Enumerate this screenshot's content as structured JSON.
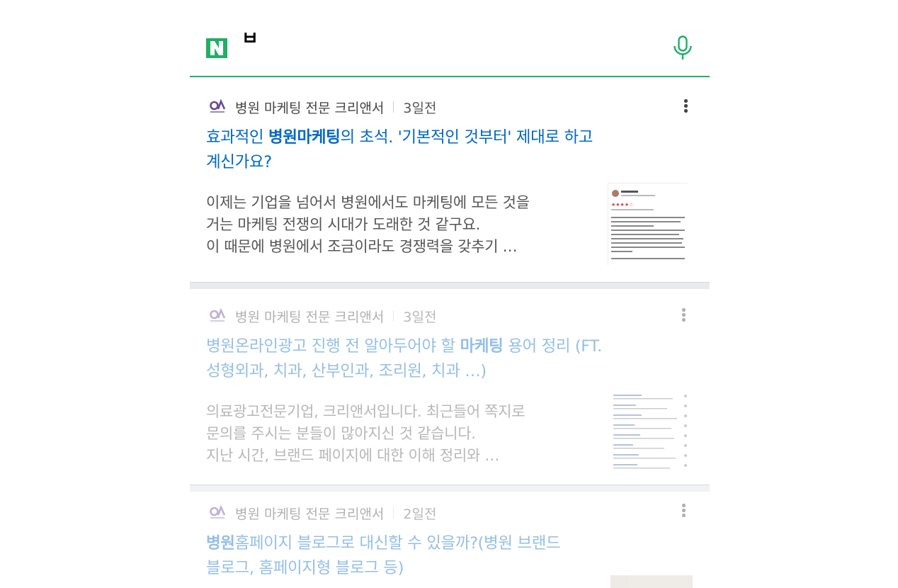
{
  "search": {
    "logo_letter": "N",
    "query": "ㅂ",
    "brand_color": "#1fb066"
  },
  "results": [
    {
      "source": "병원 마케팅 전문 크리앤서",
      "time": "3일전",
      "title_before": "효과적인 ",
      "title_highlight": "병원마케팅",
      "title_after": "의 초석. '기본적인 것부터' 제대로 하고 계신가요?",
      "desc_lines": [
        "이제는 기업을 넘어서 병원에서도 마케팅에 모든 것을",
        "거는 마케팅 전쟁의 시대가 도래한 것 같구요.",
        "이 때문에 병원에서 조금이라도 경쟁력을 갖추기 …"
      ]
    },
    {
      "source": "병원 마케팅 전문 크리앤서",
      "time": "3일전",
      "title_before": "병원온라인광고 진행 전 알아두어야 할 ",
      "title_highlight": "마케팅",
      "title_after": " 용어 정리 (FT. 성형외과, 치과, 산부인과, 조리원, 치과 …)",
      "desc_lines": [
        "의료광고전문기업, 크리앤서입니다. 최근들어 쪽지로",
        "문의를 주시는 분들이 많아지신 것 같습니다.",
        "지난 시간, 브랜드 페이지에 대한 이해 정리와 …"
      ]
    },
    {
      "source": "병원 마케팅 전문 크리앤서",
      "time": "2일전",
      "title_before": "",
      "title_highlight": "병원",
      "title_after": "홈페이지 블로그로 대신할 수 있을까?(병원 브랜드 블로그, 홈페이지형 블로그 등)",
      "desc_lines": []
    }
  ],
  "icons": {
    "search_logo": "naver-logo-icon",
    "mic": "microphone-icon",
    "more": "more-vertical-icon",
    "source_logo": "creanswer-logo-icon"
  }
}
